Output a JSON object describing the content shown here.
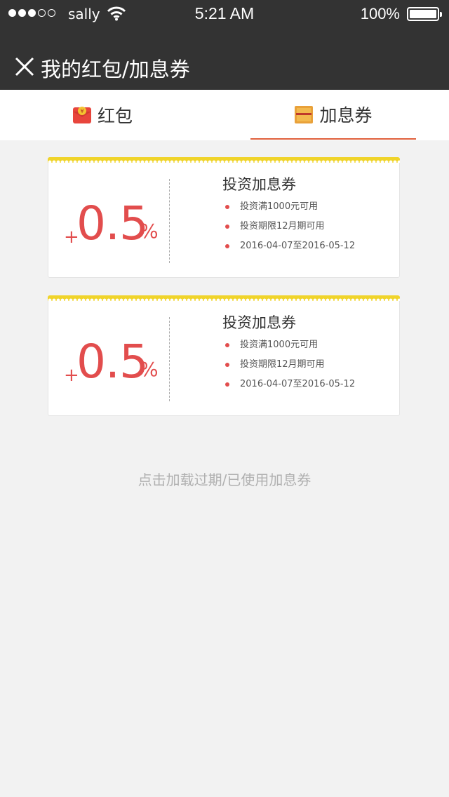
{
  "status_bar": {
    "carrier": "sally",
    "time": "5:21 AM",
    "battery": "100%"
  },
  "nav": {
    "title": "我的红包/加息券"
  },
  "tabs": [
    {
      "label": "红包",
      "icon": "red-packet-icon",
      "active": false
    },
    {
      "label": "加息券",
      "icon": "coupon-icon",
      "active": true
    }
  ],
  "coupons": [
    {
      "plus": "+",
      "rate": "0.5",
      "percent": "%",
      "title": "投资加息券",
      "conditions": [
        "投资满1000元可用",
        "投资期限12月期可用",
        "2016-04-07至2016-05-12"
      ]
    },
    {
      "plus": "+",
      "rate": "0.5",
      "percent": "%",
      "title": "投资加息券",
      "conditions": [
        "投资满1000元可用",
        "投资期限12月期可用",
        "2016-04-07至2016-05-12"
      ]
    }
  ],
  "load_more": "点击加载过期/已使用加息券",
  "colors": {
    "header_bg": "#333333",
    "accent_red": "#e24d4d",
    "tab_underline": "#e0603c",
    "ticket_edge": "#f0d42a",
    "page_bg": "#f2f2f2"
  }
}
